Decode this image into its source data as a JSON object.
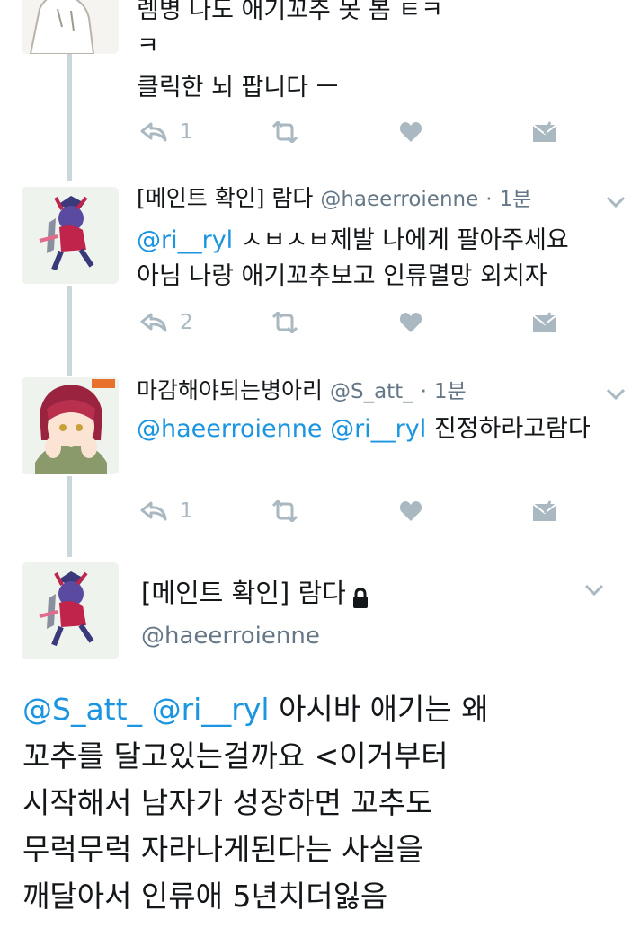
{
  "tweets": [
    {
      "lines": [
        "렘병 나도 애기꼬추 못 봄 ㅌㅋ",
        "ㅋ",
        "클릭한 뇌 팝니다 ㅡ"
      ],
      "reply_count": "1"
    },
    {
      "name": "[메인트 확인] 람다",
      "handle": "@haeerroienne",
      "sep": "·",
      "time": "1분",
      "mention1": "@ri__ryl",
      "line1_rest": " ㅅㅂㅅㅂ제발 나에게 팔아주세요",
      "line2": "아님 나랑 애기꼬추보고 인류멸망 외치자",
      "reply_count": "2"
    },
    {
      "name": "마감해야되는병아리",
      "handle": "@S_att_",
      "sep": "·",
      "time": "1분",
      "mention1": "@haeerroienne",
      "mention2": "@ri__ryl",
      "rest": " 진정하라고람다",
      "reply_count": "1"
    }
  ],
  "main_tweet": {
    "name": "[메인트 확인] 람다",
    "handle": "@haeerroienne",
    "mention1": "@S_att_",
    "mention2": "@ri__ryl",
    "line1_rest": " 아시바 애기는 왜",
    "line2": "꼬추를 달고있는걸까요 <이거부터",
    "line3": "시작해서 남자가 성장하면 꼬추도",
    "line4": "무럭무럭 자라나게된다는 사실을",
    "line5": "깨달아서 인류애 5년치더잃음"
  },
  "colors": {
    "link": "#1b95e0",
    "text": "#14171a",
    "muted": "#657786",
    "action_icon": "#aab8c2",
    "thread_line": "#ccd6dd"
  },
  "icons": [
    "reply-icon",
    "retweet-icon",
    "like-icon",
    "dm-icon",
    "chevron-down-icon",
    "lock-icon"
  ]
}
